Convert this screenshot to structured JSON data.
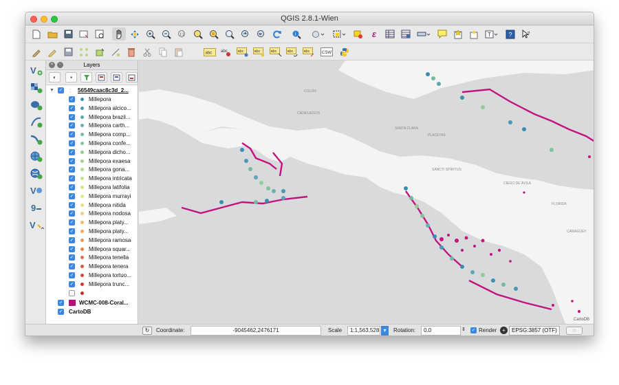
{
  "window": {
    "title": "QGIS 2.8.1-Wien"
  },
  "layers_panel": {
    "title": "Layers",
    "group": {
      "name": "56549caac8c3d_2...",
      "expand_glyph": "▼",
      "geometry_glyph": ":"
    },
    "items": [
      {
        "label": "Millepora",
        "color": "#3a8fb0",
        "checked": true
      },
      {
        "label": "Millepora alcico...",
        "color": "#4a97b6",
        "checked": true
      },
      {
        "label": "Millepora brazil...",
        "color": "#5aa6b6",
        "checked": true
      },
      {
        "label": "Millepora carth...",
        "color": "#66b2b0",
        "checked": true
      },
      {
        "label": "Millepora comp...",
        "color": "#74bba5",
        "checked": true
      },
      {
        "label": "Millepora confe...",
        "color": "#84c49c",
        "checked": true
      },
      {
        "label": "Millepora dicho...",
        "color": "#92cc96",
        "checked": true
      },
      {
        "label": "Millepora exaesa",
        "color": "#a4d48e",
        "checked": true
      },
      {
        "label": "Millepora gona...",
        "color": "#b4dc8a",
        "checked": true
      },
      {
        "label": "Millepora intricata",
        "color": "#c4e286",
        "checked": true
      },
      {
        "label": "Millepora latifolia",
        "color": "#d2e884",
        "checked": true
      },
      {
        "label": "Millepora murrayi",
        "color": "#e2ea86",
        "checked": true
      },
      {
        "label": "Millepora nitida",
        "color": "#eedc82",
        "checked": true
      },
      {
        "label": "Millepora nodosa",
        "color": "#f2cc7a",
        "checked": true
      },
      {
        "label": "Millepora platy...",
        "color": "#f4ba6e",
        "checked": true
      },
      {
        "label": "Millepora platy...",
        "color": "#f2a862",
        "checked": true
      },
      {
        "label": "Millepora ramosa",
        "color": "#ee9558",
        "checked": true
      },
      {
        "label": "Millepora squar...",
        "color": "#ea824e",
        "checked": true
      },
      {
        "label": "Millepora tenella",
        "color": "#e46e44",
        "checked": true
      },
      {
        "label": "Millepora tenera",
        "color": "#de5a3c",
        "checked": true
      },
      {
        "label": "Millepora tortuo...",
        "color": "#d84636",
        "checked": true
      },
      {
        "label": "Millepora trunc...",
        "color": "#d23430",
        "checked": true
      },
      {
        "label": "",
        "color": "#cc2a2a",
        "checked": false
      }
    ],
    "polygon_layer": {
      "label": "WCMC-008-Coral...",
      "color": "#b4127a"
    },
    "basemap_layer": {
      "label": "CartoDB"
    }
  },
  "map": {
    "place_labels": [
      {
        "text": "SANCTI SPÍRITUS"
      },
      {
        "text": "SANTA CLARA"
      },
      {
        "text": "PLACETAS"
      },
      {
        "text": "CIEGO DE ÁVILA"
      },
      {
        "text": "CAMAGÜEY"
      },
      {
        "text": "FLORIDA"
      },
      {
        "text": "COLÓN"
      },
      {
        "text": "CIENFUEGOS"
      },
      {
        "text": "CartoDB"
      }
    ]
  },
  "statusbar": {
    "coordinate_label": "Coordinate:",
    "coordinate_value": "-9045462,2476171",
    "scale_label": "Scale",
    "scale_value": "1:1,563,528",
    "rotation_label": "Rotation:",
    "rotation_value": "0.0",
    "render_label": "Render",
    "crs_label": "EPSG:3857 (OTF)"
  },
  "colors": {
    "coral_polygon": "#c2137e",
    "land": "#f4f4f4",
    "water": "#d8dadb",
    "checkbox": "#3b87e0"
  }
}
